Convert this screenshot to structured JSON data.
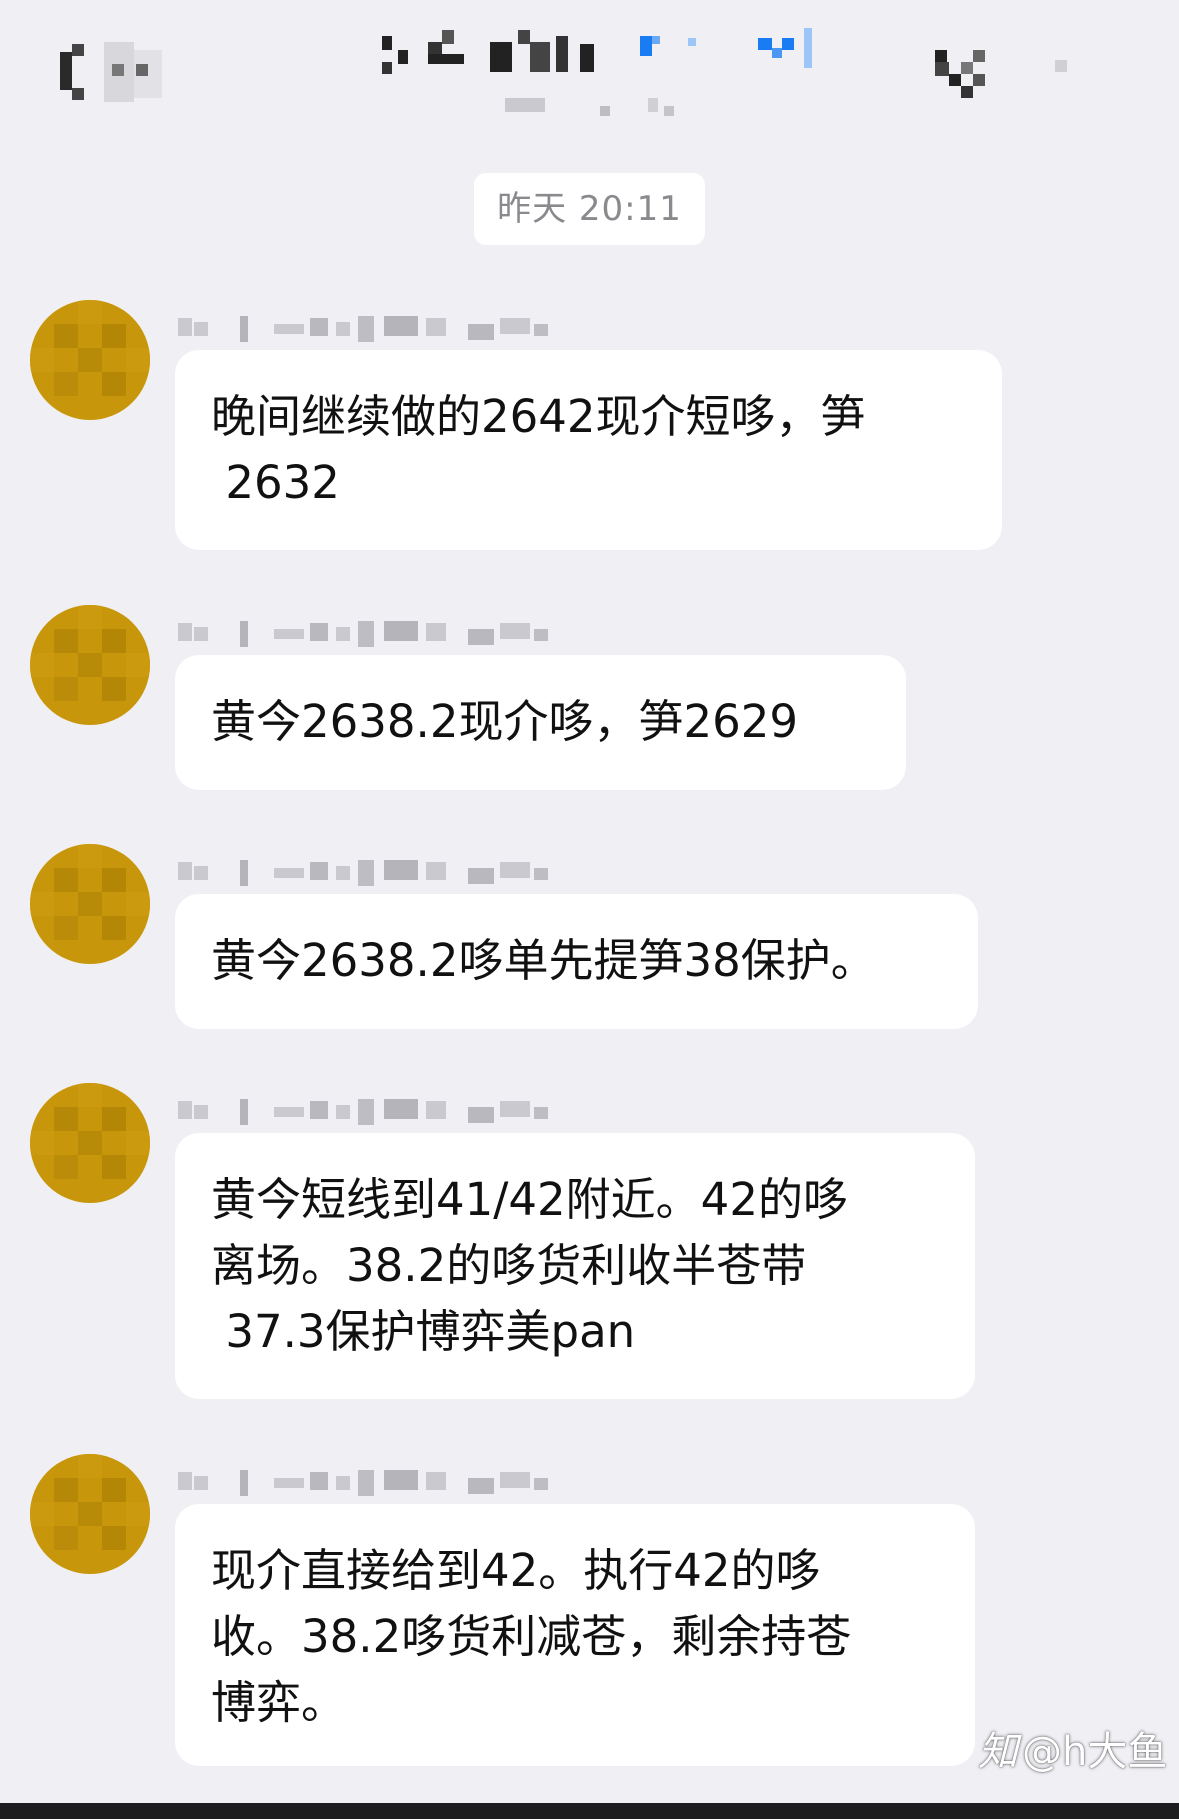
{
  "timestamp": "昨天 20:11",
  "messages": [
    {
      "text": "晚间继续做的2642现介短哆，笋\n 2632"
    },
    {
      "text": "黄今2638.2现介哆，笋2629"
    },
    {
      "text": "黄今2638.2哆单先提笋38保护。"
    },
    {
      "text": "黄今短线到41/42附近。42的哆\n离场。38.2的哆货利收半苍带\n 37.3保护博弈美pan"
    },
    {
      "text": "现介直接给到42。执行42的哆\n收。38.2哆货利减苍，剩余持苍\n博弈。"
    }
  ],
  "watermark": {
    "icon": "知",
    "text": "@h大鱼"
  },
  "colors": {
    "background": "#efeff4",
    "bubble": "#ffffff",
    "avatar": "#c8960a",
    "accent_blue": "#1a7cf2"
  },
  "icons": {
    "back": "chevron-left-icon",
    "more": "more-icon"
  }
}
